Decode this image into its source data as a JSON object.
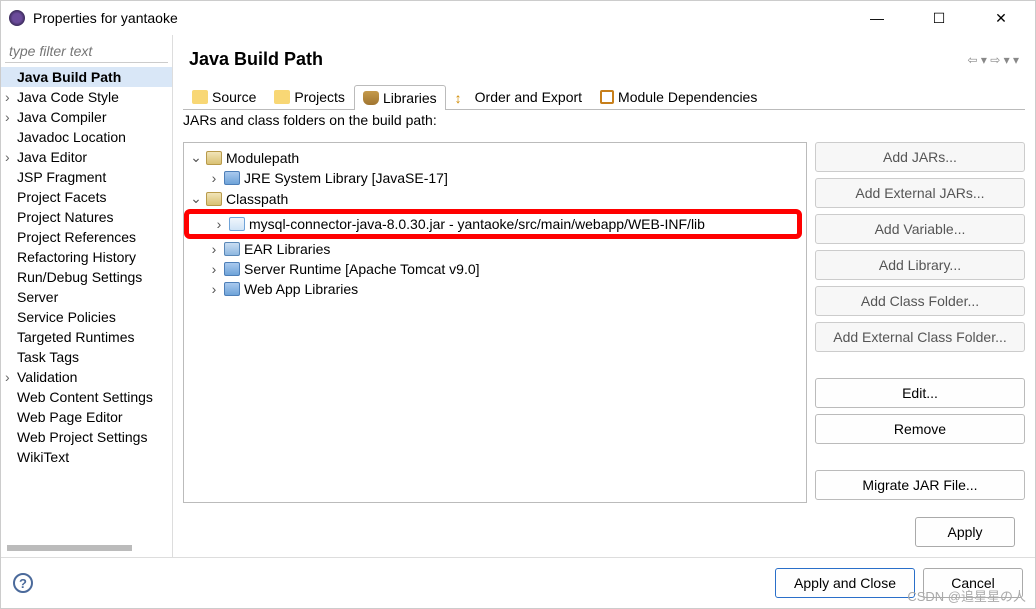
{
  "window": {
    "title": "Properties for yantaoke"
  },
  "sidebar": {
    "filter_placeholder": "type filter text",
    "items": [
      {
        "label": "Java Build Path",
        "selected": true,
        "expandable": false
      },
      {
        "label": "Java Code Style",
        "expandable": true
      },
      {
        "label": "Java Compiler",
        "expandable": true
      },
      {
        "label": "Javadoc Location"
      },
      {
        "label": "Java Editor",
        "expandable": true
      },
      {
        "label": "JSP Fragment"
      },
      {
        "label": "Project Facets"
      },
      {
        "label": "Project Natures"
      },
      {
        "label": "Project References"
      },
      {
        "label": "Refactoring History"
      },
      {
        "label": "Run/Debug Settings"
      },
      {
        "label": "Server"
      },
      {
        "label": "Service Policies"
      },
      {
        "label": "Targeted Runtimes"
      },
      {
        "label": "Task Tags"
      },
      {
        "label": "Validation",
        "expandable": true
      },
      {
        "label": "Web Content Settings"
      },
      {
        "label": "Web Page Editor"
      },
      {
        "label": "Web Project Settings"
      },
      {
        "label": "WikiText"
      }
    ]
  },
  "main": {
    "heading": "Java Build Path",
    "tabs": {
      "source": "Source",
      "projects": "Projects",
      "libraries": "Libraries",
      "order": "Order and Export",
      "module": "Module Dependencies"
    },
    "description": "JARs and class folders on the build path:",
    "tree": {
      "modulepath": "Modulepath",
      "jre": "JRE System Library [JavaSE-17]",
      "classpath": "Classpath",
      "mysql": "mysql-connector-java-8.0.30.jar - yantaoke/src/main/webapp/WEB-INF/lib",
      "ear": "EAR Libraries",
      "server": "Server Runtime [Apache Tomcat v9.0]",
      "webapp": "Web App Libraries"
    },
    "buttons": {
      "add_jars": "Add JARs...",
      "add_external_jars": "Add External JARs...",
      "add_variable": "Add Variable...",
      "add_library": "Add Library...",
      "add_class_folder": "Add Class Folder...",
      "add_external_class_folder": "Add External Class Folder...",
      "edit": "Edit...",
      "remove": "Remove",
      "migrate": "Migrate JAR File..."
    },
    "apply": "Apply"
  },
  "footer": {
    "apply_close": "Apply and Close",
    "cancel": "Cancel"
  },
  "watermark": "CSDN @追星星の人"
}
